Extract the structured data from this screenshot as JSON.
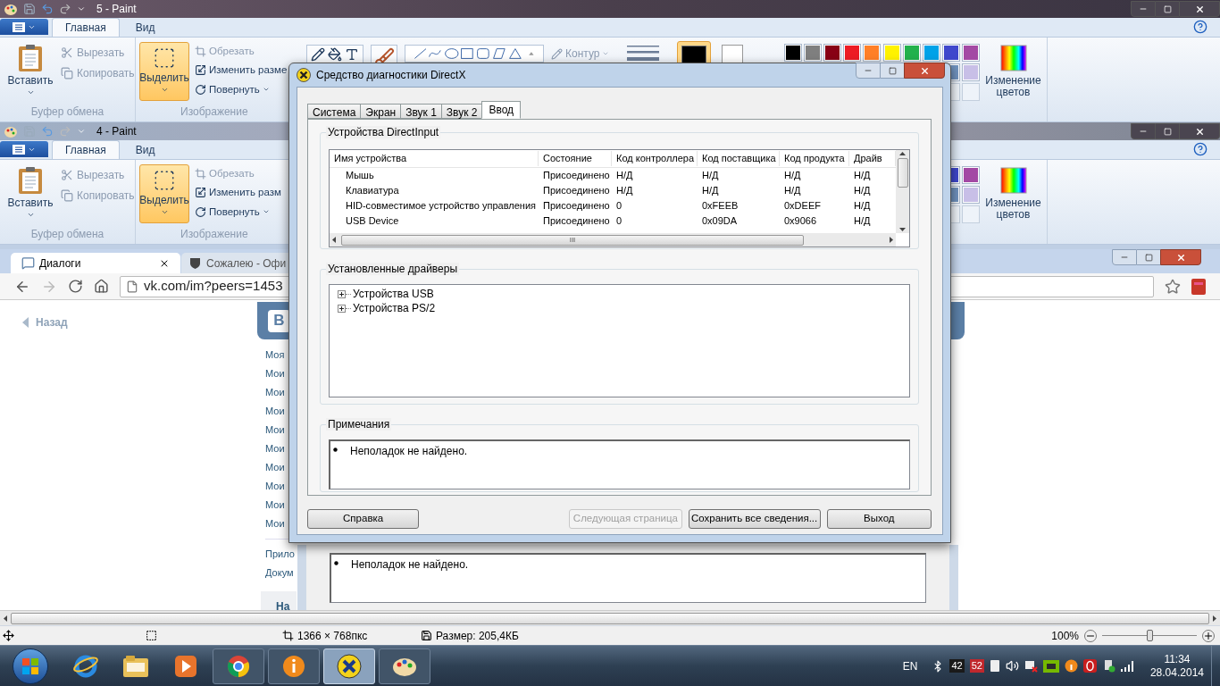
{
  "paint": {
    "title": "5 - Paint",
    "tabs": [
      {
        "label": "Главная",
        "selected": true
      },
      {
        "label": "Вид",
        "selected": false
      }
    ],
    "ribbon": {
      "paste": "Вставить",
      "cut": "Вырезать",
      "copy": "Копировать",
      "clipboard_group": "Буфер обмена",
      "select": "Выделить",
      "crop": "Обрезать",
      "resize": "Изменить разме",
      "rotate": "Повернуть",
      "image_group": "Изображение",
      "outline": "Контур",
      "edit_colors": "Изменение цветов"
    },
    "palette": [
      {
        "color": "#000000"
      },
      {
        "color": "#7f7f7f"
      },
      {
        "color": "#880015"
      },
      {
        "color": "#ed1c24"
      },
      {
        "color": "#ff7f27"
      },
      {
        "color": "#fff200"
      },
      {
        "color": "#22b14c"
      },
      {
        "color": "#00a2e8"
      },
      {
        "color": "#3f48cc"
      },
      {
        "color": "#a349a4"
      }
    ],
    "palette_row2": [
      {
        "color": "#7092be"
      },
      {
        "color": "#c8bfe7"
      }
    ],
    "status": {
      "dimensions": "1366 × 768пкс",
      "size": "Размер: 205,4КБ",
      "zoom": "100%",
      "zoom_slider": {
        "level": 0.5
      }
    }
  },
  "inner_paint": {
    "title": "4 - Paint",
    "tabs": [
      {
        "label": "Главная",
        "selected": true
      },
      {
        "label": "Вид",
        "selected": false
      }
    ],
    "ribbon": {
      "paste": "Вставить",
      "cut": "Вырезать",
      "copy": "Копировать",
      "clipboard_group": "Буфер обмена",
      "select": "Выделить",
      "crop": "Обрезать",
      "resize": "Изменить разм",
      "rotate": "Повернуть",
      "image_group": "Изображение",
      "edit_colors": "Изменение цветов"
    },
    "palette": [
      {
        "color": "#3f48cc"
      },
      {
        "color": "#a349a4"
      }
    ],
    "palette_row2": [
      {
        "color": "#7092be"
      },
      {
        "color": "#c8bfe7"
      }
    ]
  },
  "browser": {
    "tabs": [
      {
        "title": "Диалоги",
        "selected": true
      },
      {
        "title": "Сожалею - Офи",
        "selected": false
      }
    ],
    "url": "vk.com/im?peers=1453",
    "back": "Назад",
    "logo": "В",
    "menu": [
      "Моя",
      "Мои",
      "Мои",
      "Мои",
      "Мои",
      "Мои",
      "Мои",
      "Мои",
      "Мои",
      "Мои"
    ],
    "menu2": [
      "Прило",
      "Докум"
    ],
    "section": "На"
  },
  "behind_dialog": {
    "note": "Неполадок не найдено."
  },
  "dialog": {
    "title": "Средство диагностики DirectX",
    "tabs": [
      {
        "label": "Система",
        "selected": false
      },
      {
        "label": "Экран",
        "selected": false
      },
      {
        "label": "Звук 1",
        "selected": false
      },
      {
        "label": "Звук 2",
        "selected": false
      },
      {
        "label": "Ввод",
        "selected": true
      }
    ],
    "devices": {
      "title": "Устройства DirectInput",
      "columns": [
        "Имя устройства",
        "Состояние",
        "Код контроллера",
        "Код поставщика",
        "Код продукта",
        "Драйв"
      ],
      "rows": [
        [
          "Мышь",
          "Присоединено",
          "Н/Д",
          "Н/Д",
          "Н/Д",
          "Н/Д"
        ],
        [
          "Клавиатура",
          "Присоединено",
          "Н/Д",
          "Н/Д",
          "Н/Д",
          "Н/Д"
        ],
        [
          "HID-совместимое устройство управления",
          "Присоединено",
          "0",
          "0xFEEB",
          "0xDEEF",
          "Н/Д"
        ],
        [
          "USB Device",
          "Присоединено",
          "0",
          "0x09DA",
          "0x9066",
          "Н/Д"
        ]
      ],
      "scroll_label": "III"
    },
    "drivers": {
      "title": "Установленные драйверы",
      "tree": [
        {
          "label": "Устройства USB",
          "expanded": false
        },
        {
          "label": "Устройства PS/2",
          "expanded": false
        }
      ]
    },
    "notes": {
      "title": "Примечания",
      "items": [
        "Неполадок не найдено."
      ]
    },
    "buttons": [
      {
        "label": "Справка",
        "disabled": false
      },
      {
        "label": "Следующая страница",
        "disabled": true
      },
      {
        "label": "Сохранить все сведения...",
        "disabled": false
      },
      {
        "label": "Выход",
        "disabled": false
      }
    ]
  },
  "taskbar": {
    "language": "EN",
    "badges": [
      {
        "text": "42",
        "color": "#1a1a1a"
      },
      {
        "text": "52",
        "color": "#c0282d"
      }
    ],
    "time": "11:34",
    "date": "28.04.2014"
  }
}
